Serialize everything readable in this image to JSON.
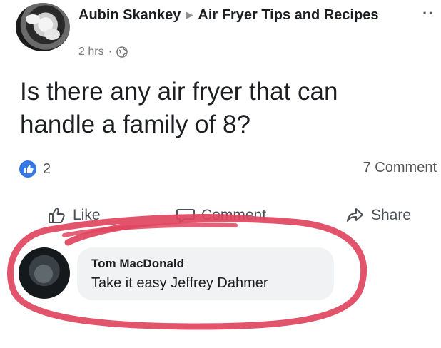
{
  "post": {
    "author": "Aubin Skankey",
    "group": "Air Fryer Tips and Recipes",
    "time": "2 hrs",
    "separator": "·",
    "text": "Is there any air fryer that can handle a family of 8?",
    "more_label": "··",
    "reaction_count": "2",
    "comment_count": "7 Comment"
  },
  "actions": {
    "like": "Like",
    "comment": "Comment",
    "share": "Share"
  },
  "comment": {
    "author": "Tom MacDonald",
    "text": "Take it easy Jeffrey Dahmer"
  },
  "colors": {
    "facebook_blue": "#1877f2",
    "annotation_red": "#e0455f"
  },
  "icons": {
    "group_arrow": "triangle-right-icon",
    "privacy": "globe-icon",
    "reaction": "like-reaction-icon",
    "like": "thumbs-up-icon",
    "comment": "comment-bubble-icon",
    "share": "share-arrow-icon"
  }
}
